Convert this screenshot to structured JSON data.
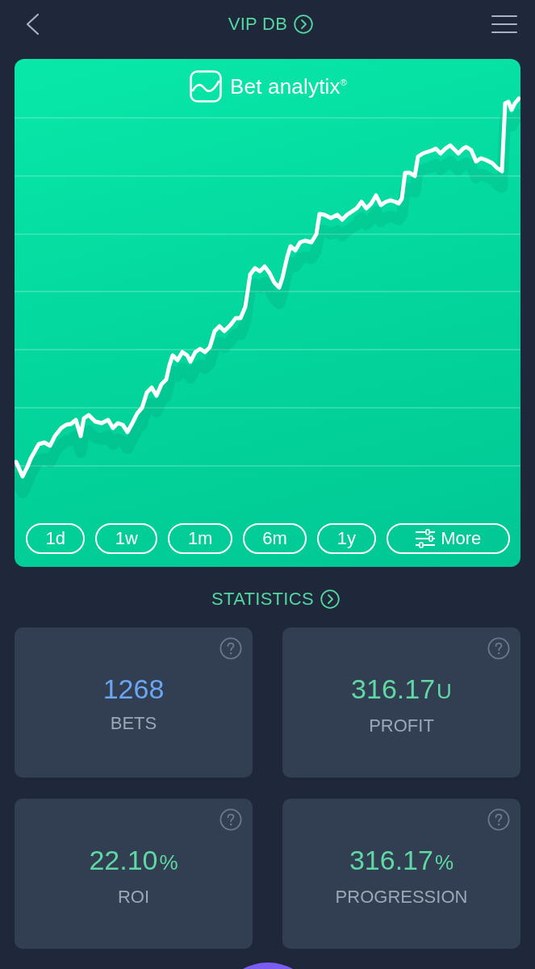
{
  "header": {
    "title": "VIP DB"
  },
  "chart": {
    "logo_text": "Bet analytix$^{®}$",
    "ranges": [
      {
        "label": "1d",
        "kind": "range",
        "selected": false
      },
      {
        "label": "1w",
        "kind": "range",
        "selected": false
      },
      {
        "label": "1m",
        "kind": "range",
        "selected": false
      },
      {
        "label": "6m",
        "kind": "range",
        "selected": false
      },
      {
        "label": "1y",
        "kind": "range",
        "selected": false
      },
      {
        "label": "More",
        "kind": "filter",
        "selected": false
      }
    ]
  },
  "statistics": {
    "title": "STATISTICS",
    "cards": [
      {
        "value": "1268",
        "label": "BETS",
        "color": "#6ba6f2"
      },
      {
        "value": "316.17",
        "unit": "U",
        "label": "PROFIT",
        "color": "#5fd8a4"
      },
      {
        "value": "22.10",
        "unit": "%",
        "label": "ROI",
        "color": "#5fd8a4"
      },
      {
        "value": "316.17",
        "unit": "%",
        "label": "PROGRESSION",
        "color": "#5fd8a4"
      }
    ]
  }
}
